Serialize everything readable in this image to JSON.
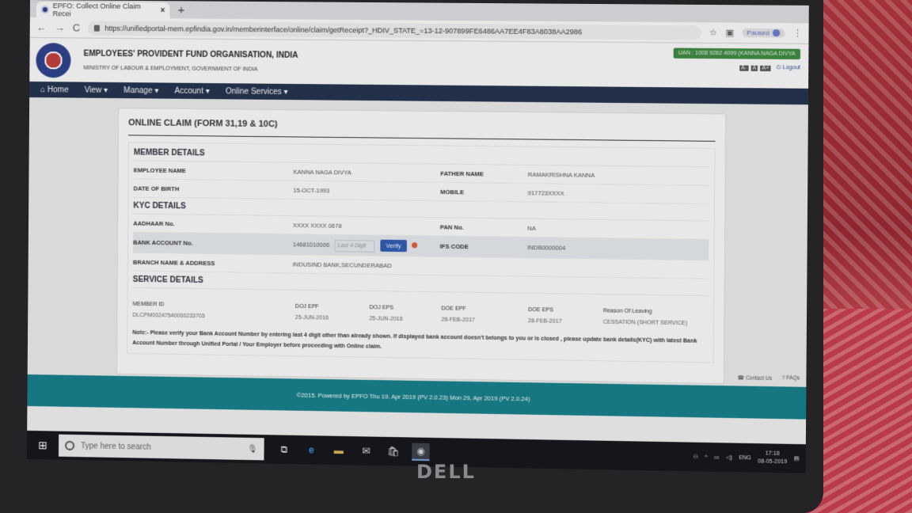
{
  "browser": {
    "tab_title": "EPFO: Collect Online Claim Recei",
    "tab_close": "×",
    "new_tab": "+",
    "back": "←",
    "forward": "→",
    "reload": "C",
    "url": "https://unifiedportal-mem.epfindia.gov.in/memberinterface/online/claim/getReceipt?_HDIV_STATE_=13-12-907899FE6486AA7EE4F83A8038AA2986",
    "paused_label": "Paused"
  },
  "header": {
    "org_name": "EMPLOYEES' PROVIDENT FUND ORGANISATION, INDIA",
    "ministry": "MINISTRY OF LABOUR & EMPLOYMENT, GOVERNMENT OF INDIA",
    "uan_text": "UAN : 1008 9262 4099 (KANNA NAGA DIVYA",
    "font_sizes": [
      "A-",
      "A",
      "A+"
    ],
    "logout": "Logout"
  },
  "nav": {
    "items": [
      "Home",
      "View",
      "Manage",
      "Account",
      "Online Services"
    ]
  },
  "claim": {
    "title": "ONLINE CLAIM (FORM 31,19 & 10C)",
    "member": {
      "heading": "MEMBER DETAILS",
      "employee_name_label": "EMPLOYEE NAME",
      "employee_name": "KANNA NAGA DIVYA",
      "father_name_label": "FATHER NAME",
      "father_name": "RAMAKRISHNA KANNA",
      "dob_label": "DATE OF BIRTH",
      "dob": "15-OCT-1993",
      "mobile_label": "MOBILE",
      "mobile": "917723XXXX"
    },
    "kyc": {
      "heading": "KYC DETAILS",
      "aadhaar_label": "AADHAAR No.",
      "aadhaar": "XXXX XXXX 0678",
      "pan_label": "PAN No.",
      "pan": "NA",
      "bank_label": "BANK ACCOUNT No.",
      "bank_account": "14681010006",
      "last4_placeholder": "Last 4 Digit",
      "verify": "Verify",
      "ifs_label": "IFS CODE",
      "ifs": "INDB0000004",
      "branch_label": "BRANCH NAME & ADDRESS",
      "branch": "INDUSIND BANK,SECUNDERABAD"
    },
    "service": {
      "heading": "SERVICE DETAILS",
      "headers": [
        "MEMBER ID",
        "DOJ EPF",
        "DOJ EPS",
        "DOE EPF",
        "DOE EPS",
        "Reason Of Leaving"
      ],
      "row": [
        "DLCPM00247540000233703",
        "25-JUN-2016",
        "25-JUN-2016",
        "28-FEB-2017",
        "28-FEB-2017",
        "CESSATION (SHORT SERVICE)"
      ]
    },
    "note": "Note:- Please verify your Bank Account Number by entering last 4 digit other than already shown. If displayed bank account doesn't belongs to you or is closed , please update bank details(KYC) with latest Bank Account Number through Unified Portal / Your Employer before proceeding with Online claim."
  },
  "links": {
    "contact": "Contact Us",
    "faqs": "FAQs"
  },
  "footer": {
    "text": "©2015. Powered by EPFO Thu 19, Apr 2019 (PV 2.0.23) Mon 29, Apr 2019 (PV 2.0.24)"
  },
  "taskbar": {
    "search_placeholder": "Type here to search",
    "lang": "ENG",
    "time": "17:18",
    "date": "08-05-2019"
  },
  "brand": "DELL",
  "colors": {
    "navbar": "#1f2f4c",
    "footer": "#12808c",
    "verify_button": "#2c5bb5",
    "uan_badge": "#3b8a3e"
  }
}
